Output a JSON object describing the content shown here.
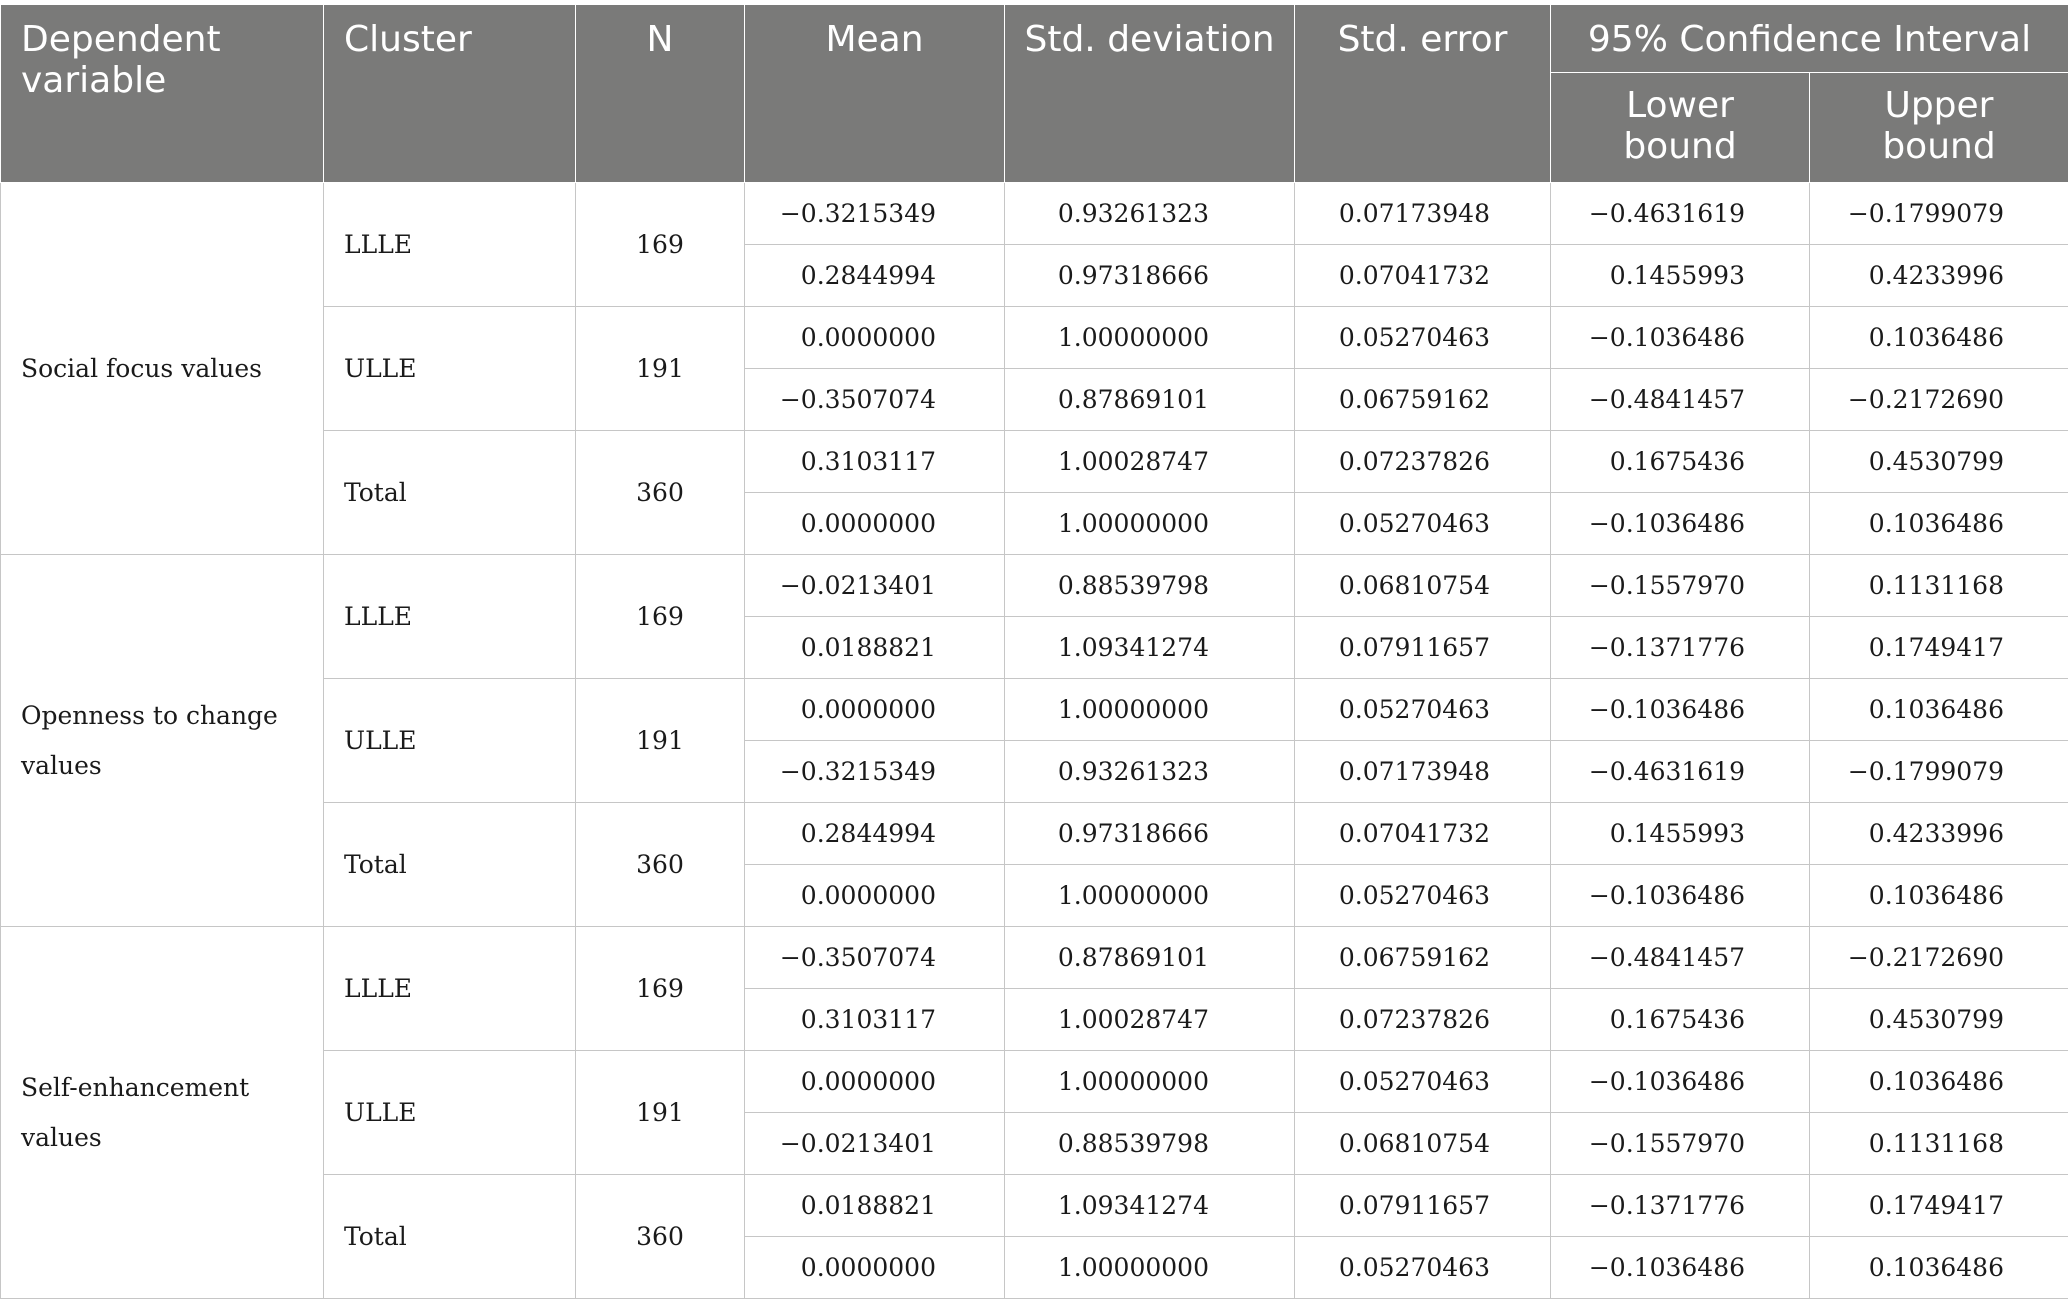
{
  "table": {
    "headers": {
      "dependent_variable": "Dependent variable",
      "cluster": "Cluster",
      "n": "N",
      "mean": "Mean",
      "std_deviation": "Std. deviation",
      "std_error": "Std. error",
      "ci": "95% Confidence Interval",
      "lower_bound": "Lower bound",
      "upper_bound": "Upper bound"
    },
    "groups": [
      {
        "variable": "Social focus values",
        "clusters": [
          {
            "name": "LLLE",
            "n": "169",
            "rows": [
              {
                "mean": "−0.3215349",
                "sd": "0.93261323",
                "se": "0.07173948",
                "lower": "−0.4631619",
                "upper": "−0.1799079"
              },
              {
                "mean": "0.2844994",
                "sd": "0.97318666",
                "se": "0.07041732",
                "lower": "0.1455993",
                "upper": "0.4233996"
              }
            ]
          },
          {
            "name": "ULLE",
            "n": "191",
            "rows": [
              {
                "mean": "0.0000000",
                "sd": "1.00000000",
                "se": "0.05270463",
                "lower": "−0.1036486",
                "upper": "0.1036486"
              },
              {
                "mean": "−0.3507074",
                "sd": "0.87869101",
                "se": "0.06759162",
                "lower": "−0.4841457",
                "upper": "−0.2172690"
              }
            ]
          },
          {
            "name": "Total",
            "n": "360",
            "rows": [
              {
                "mean": "0.3103117",
                "sd": "1.00028747",
                "se": "0.07237826",
                "lower": "0.1675436",
                "upper": "0.4530799"
              },
              {
                "mean": "0.0000000",
                "sd": "1.00000000",
                "se": "0.05270463",
                "lower": "−0.1036486",
                "upper": "0.1036486"
              }
            ]
          }
        ]
      },
      {
        "variable": "Openness to change values",
        "clusters": [
          {
            "name": "LLLE",
            "n": "169",
            "rows": [
              {
                "mean": "−0.0213401",
                "sd": "0.88539798",
                "se": "0.06810754",
                "lower": "−0.1557970",
                "upper": "0.1131168"
              },
              {
                "mean": "0.0188821",
                "sd": "1.09341274",
                "se": "0.07911657",
                "lower": "−0.1371776",
                "upper": "0.1749417"
              }
            ]
          },
          {
            "name": "ULLE",
            "n": "191",
            "rows": [
              {
                "mean": "0.0000000",
                "sd": "1.00000000",
                "se": "0.05270463",
                "lower": "−0.1036486",
                "upper": "0.1036486"
              },
              {
                "mean": "−0.3215349",
                "sd": "0.93261323",
                "se": "0.07173948",
                "lower": "−0.4631619",
                "upper": "−0.1799079"
              }
            ]
          },
          {
            "name": "Total",
            "n": "360",
            "rows": [
              {
                "mean": "0.2844994",
                "sd": "0.97318666",
                "se": "0.07041732",
                "lower": "0.1455993",
                "upper": "0.4233996"
              },
              {
                "mean": "0.0000000",
                "sd": "1.00000000",
                "se": "0.05270463",
                "lower": "−0.1036486",
                "upper": "0.1036486"
              }
            ]
          }
        ]
      },
      {
        "variable": "Self-enhancement values",
        "clusters": [
          {
            "name": "LLLE",
            "n": "169",
            "rows": [
              {
                "mean": "−0.3507074",
                "sd": "0.87869101",
                "se": "0.06759162",
                "lower": "−0.4841457",
                "upper": "−0.2172690"
              },
              {
                "mean": "0.3103117",
                "sd": "1.00028747",
                "se": "0.07237826",
                "lower": "0.1675436",
                "upper": "0.4530799"
              }
            ]
          },
          {
            "name": "ULLE",
            "n": "191",
            "rows": [
              {
                "mean": "0.0000000",
                "sd": "1.00000000",
                "se": "0.05270463",
                "lower": "−0.1036486",
                "upper": "0.1036486"
              },
              {
                "mean": "−0.0213401",
                "sd": "0.88539798",
                "se": "0.06810754",
                "lower": "−0.1557970",
                "upper": "0.1131168"
              }
            ]
          },
          {
            "name": "Total",
            "n": "360",
            "rows": [
              {
                "mean": "0.0188821",
                "sd": "1.09341274",
                "se": "0.07911657",
                "lower": "−0.1371776",
                "upper": "0.1749417"
              },
              {
                "mean": "0.0000000",
                "sd": "1.00000000",
                "se": "0.05270463",
                "lower": "−0.1036486",
                "upper": "0.1036486"
              }
            ]
          }
        ]
      }
    ]
  },
  "colors": {
    "header_bg": "#7a7a79",
    "header_text": "#ffffff",
    "grid": "#c6c6c6",
    "body_text": "#1a1a1a"
  }
}
